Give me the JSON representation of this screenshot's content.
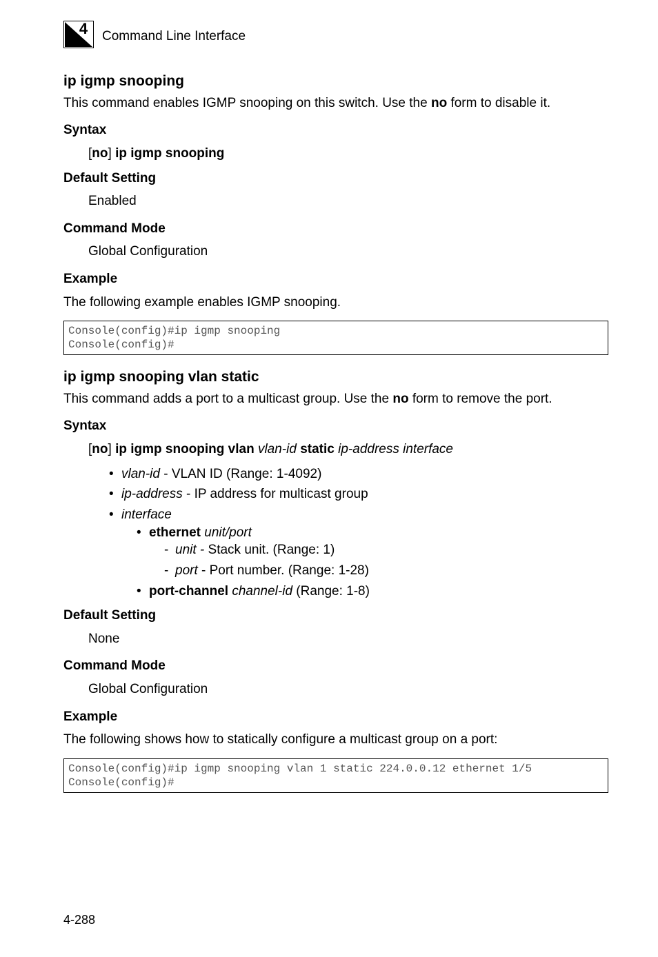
{
  "header": {
    "chapter_number": "4",
    "title": "Command Line Interface"
  },
  "section1": {
    "heading": "ip igmp snooping",
    "intro_pre": "This command enables IGMP snooping on this switch. Use the ",
    "intro_bold": "no",
    "intro_post": " form to disable it.",
    "syntax_label": "Syntax",
    "syntax_no": "no",
    "syntax_rest": "ip igmp snooping",
    "default_label": "Default Setting",
    "default_value": "Enabled",
    "mode_label": "Command Mode",
    "mode_value": "Global Configuration",
    "example_label": "Example",
    "example_text": "The following example enables IGMP snooping.",
    "code": "Console(config)#ip igmp snooping\nConsole(config)#"
  },
  "section2": {
    "heading": "ip igmp snooping vlan static",
    "intro_pre": "This command adds a port to a multicast group. Use the ",
    "intro_bold": "no",
    "intro_post": " form to remove the port.",
    "syntax_label": "Syntax",
    "syntax_no": "no",
    "syntax_b1": "ip igmp snooping vlan",
    "syntax_i1": "vlan-id",
    "syntax_b2": "static",
    "syntax_i2": "ip-address interface",
    "bullets": {
      "vlan_i": "vlan-id",
      "vlan_t": " - VLAN ID (Range: 1-4092)",
      "ip_i": "ip-address",
      "ip_t": " - IP address for multicast group",
      "iface_i": "interface",
      "eth_b": "ethernet",
      "eth_i1": "unit",
      "eth_sep": "/",
      "eth_i2": "port",
      "unit_i": "unit",
      "unit_dash": " - ",
      "unit_t": "Stack unit. (Range: 1)",
      "port_i": "port",
      "port_t": " - Port number. (Range: 1-28)",
      "pc_b": "port-channel",
      "pc_i": "channel-id",
      "pc_t": " (Range: 1-8)"
    },
    "default_label": "Default Setting",
    "default_value": "None",
    "mode_label": "Command Mode",
    "mode_value": "Global Configuration",
    "example_label": "Example",
    "example_text": "The following shows how to statically configure a multicast group on a port:",
    "code": "Console(config)#ip igmp snooping vlan 1 static 224.0.0.12 ethernet 1/5\nConsole(config)#"
  },
  "page_number": "4-288"
}
